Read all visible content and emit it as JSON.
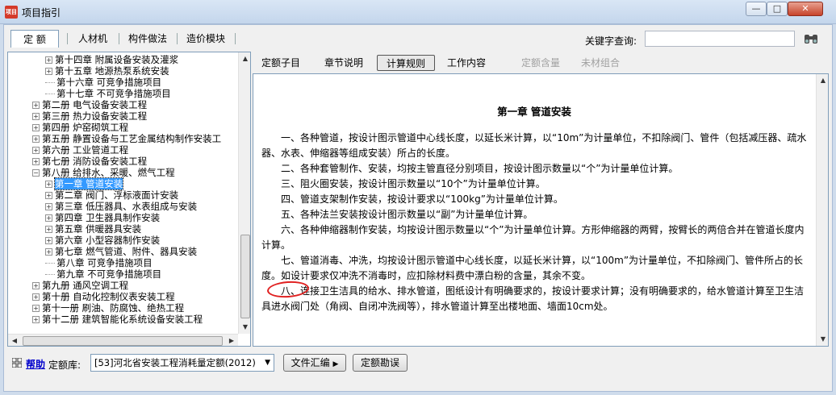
{
  "window": {
    "title": "项目指引",
    "icon_label": "项目",
    "controls": {
      "minimize": "—",
      "maximize": "□",
      "close": "✕"
    }
  },
  "top_tabs": [
    "定 额",
    "人材机",
    "构件做法",
    "造价模块"
  ],
  "search": {
    "label": "关键字查询:",
    "value": ""
  },
  "tree": {
    "items": [
      {
        "label": "第十四章 附属设备安装及灌浆",
        "expander": "+"
      },
      {
        "label": "第十五章 地源热泵系统安装",
        "expander": "+"
      },
      {
        "label": "第十六章 可竞争措施项目",
        "expander": ""
      },
      {
        "label": "第十七章 不可竞争措施项目",
        "expander": ""
      },
      {
        "label": "第二册 电气设备安装工程",
        "expander": "+"
      },
      {
        "label": "第三册 热力设备安装工程",
        "expander": "+"
      },
      {
        "label": "第四册 炉窑砌筑工程",
        "expander": "+"
      },
      {
        "label": "第五册 静置设备与工艺金属结构制作安装工",
        "expander": "+"
      },
      {
        "label": "第六册 工业管道工程",
        "expander": "+"
      },
      {
        "label": "第七册 消防设备安装工程",
        "expander": "+"
      },
      {
        "label": "第八册 给排水、采暖、燃气工程",
        "expander": "−"
      },
      {
        "label": "第一章 管道安装",
        "expander": "+"
      },
      {
        "label": "第二章 阀门、浮标液面计安装",
        "expander": "+"
      },
      {
        "label": "第三章 低压器具、水表组成与安装",
        "expander": "+"
      },
      {
        "label": "第四章 卫生器具制作安装",
        "expander": "+"
      },
      {
        "label": "第五章 供暖器具安装",
        "expander": "+"
      },
      {
        "label": "第六章 小型容器制作安装",
        "expander": "+"
      },
      {
        "label": "第七章 燃气管道、附件、器具安装",
        "expander": "+"
      },
      {
        "label": "第八章 可竞争措施项目",
        "expander": ""
      },
      {
        "label": "第九章 不可竞争措施项目",
        "expander": ""
      },
      {
        "label": "第九册 通风空调工程",
        "expander": "+"
      },
      {
        "label": "第十册 自动化控制仪表安装工程",
        "expander": "+"
      },
      {
        "label": "第十一册 刷油、防腐蚀、绝热工程",
        "expander": "+"
      },
      {
        "label": "第十二册 建筑智能化系统设备安装工程",
        "expander": "+"
      }
    ],
    "selected": "第一章 管道安装"
  },
  "right_tabs": [
    {
      "label": "定额子目",
      "state": "normal"
    },
    {
      "label": "章节说明",
      "state": "normal"
    },
    {
      "label": "计算规则",
      "state": "active"
    },
    {
      "label": "工作内容",
      "state": "normal"
    },
    {
      "label": "定额含量",
      "state": "disabled"
    },
    {
      "label": "未材组合",
      "state": "disabled"
    }
  ],
  "document": {
    "title": "第一章 管道安装",
    "paragraphs": [
      "一、各种管道，按设计图示管道中心线长度，以延长米计算，以“10m”为计量单位，不扣除阀门、管件（包括减压器、疏水器、水表、伸缩器等组成安装）所占的长度。",
      "二、各种套管制作、安装，均按主管直径分别项目，按设计图示数量以“个”为计量单位计算。",
      "三、阻火圈安装，按设计图示数量以“10个”为计量单位计算。",
      "四、管道支架制作安装，按设计要求以“100kg”为计量单位计算。",
      "五、各种法兰安装按设计图示数量以“副”为计量单位计算。",
      "六、各种伸缩器制作安装，均按设计图示数量以“个”为计量单位计算。方形伸缩器的两臂，按臂长的两倍合并在管道长度内计算。",
      "七、管道消毒、冲洗，均按设计图示管道中心线长度，以延长米计算，以“100m”为计量单位，不扣除阀门、管件所占的长度。如设计要求仅冲洗不消毒时，应扣除材料费中漂白粉的含量，其余不变。",
      "八、连接卫生洁具的给水、排水管道，图纸设计有明确要求的，按设计要求计算；没有明确要求的，给水管道计算至卫生洁具进水阀门处（角阀、自闭冲洗阀等），排水管道计算至出楼地面、墙面10cm处。"
    ]
  },
  "bottom": {
    "help": "帮助",
    "library_label": "定额库:",
    "library_value": "[53]河北省安装工程消耗量定额(2012)",
    "summary_button": "文件汇编",
    "errata_button": "定额勘误"
  },
  "colors": {
    "selected_bg": "#3399ff",
    "annotation_circle": "#e02020",
    "help_link": "#0000cc"
  }
}
